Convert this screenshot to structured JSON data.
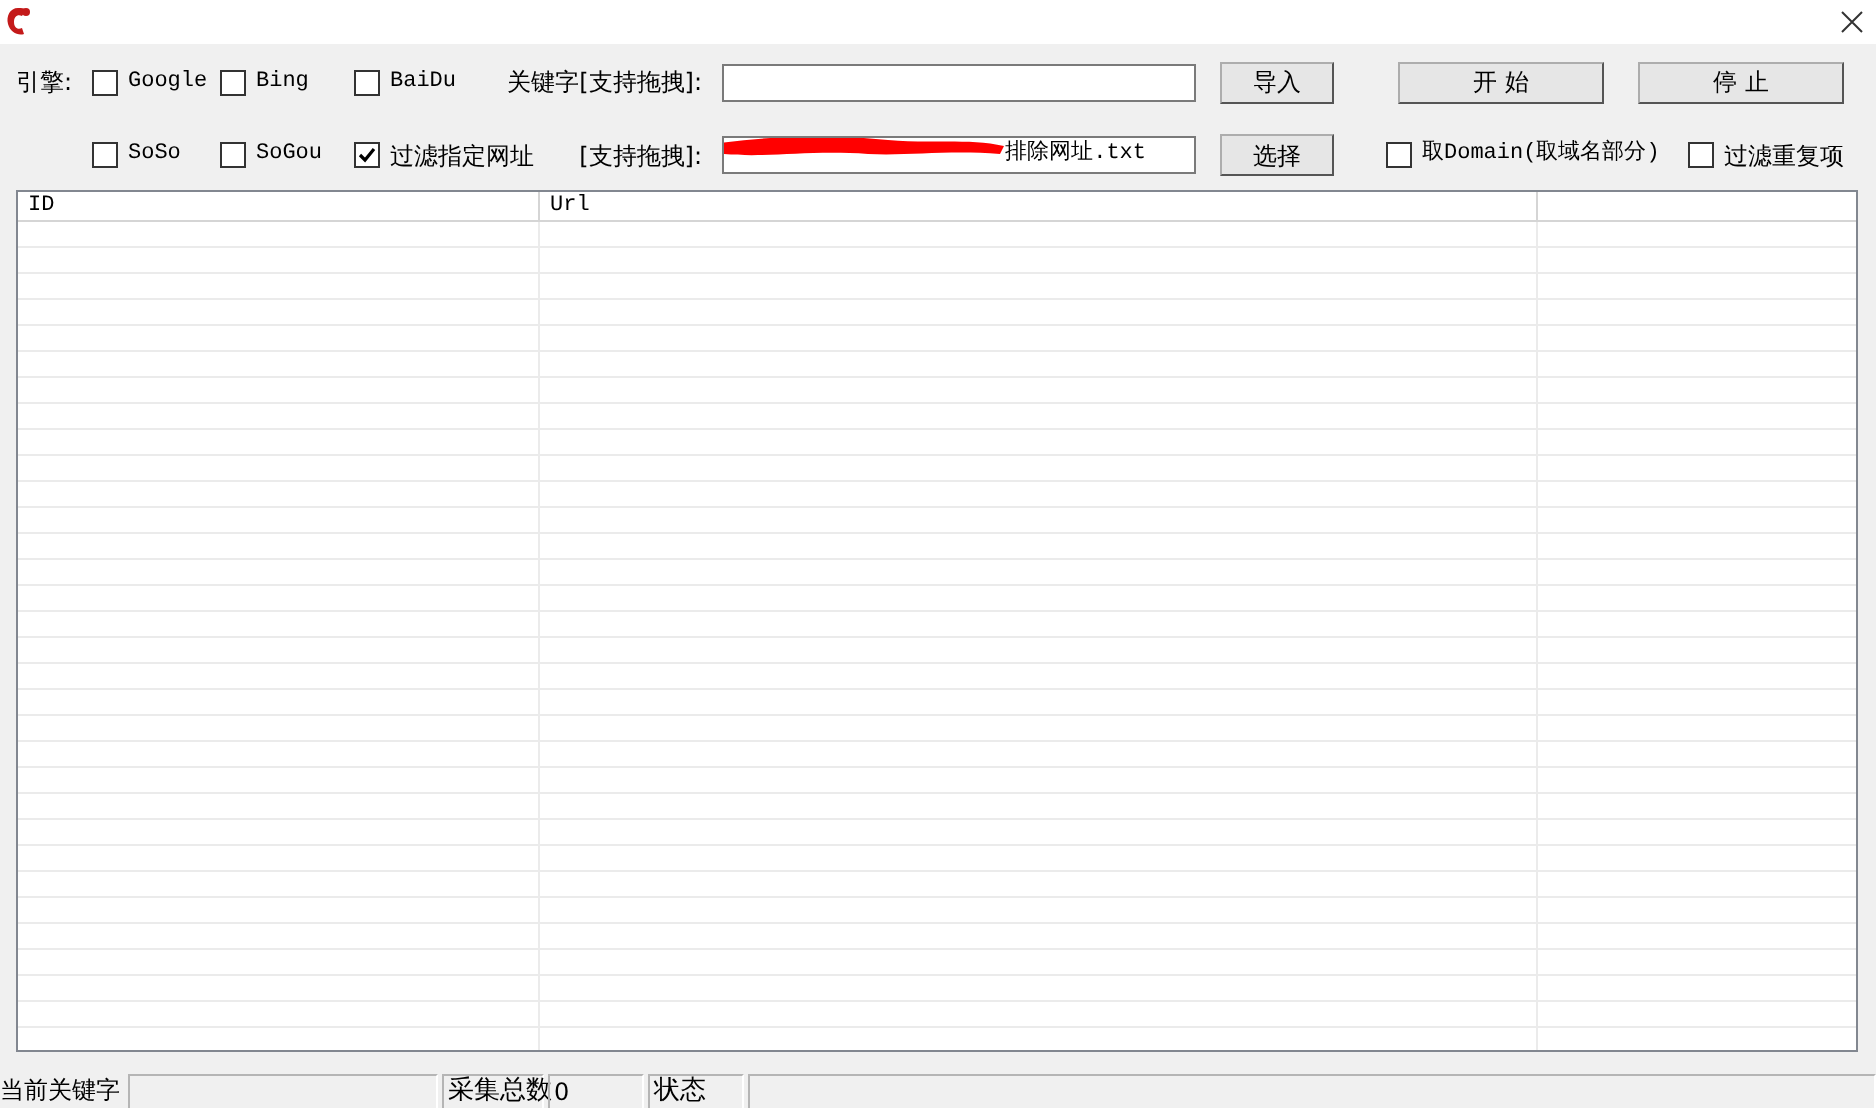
{
  "engine_label": "引擎:",
  "row1_options": [
    {
      "label": "Google",
      "checked": false
    },
    {
      "label": "Bing",
      "checked": false
    },
    {
      "label": "BaiDu",
      "checked": false
    }
  ],
  "keyword": {
    "label": "关键字[支持拖拽]:"
  },
  "import_button": "导入",
  "start_button": "开 始",
  "stop_button": "停 止",
  "row2_options": [
    {
      "label": "SoSo",
      "checked": false
    },
    {
      "label": "SoGou",
      "checked": false
    },
    {
      "label": "过滤指定网址",
      "checked": true
    }
  ],
  "filter_file": {
    "label": "[支持拖拽]:",
    "value": "排除网址.txt",
    "redacted": true
  },
  "select_button": "选择",
  "extra_options": [
    {
      "label": "取Domain(取域名部分)",
      "checked": false
    },
    {
      "label": "过滤重复项",
      "checked": false
    }
  ],
  "table": {
    "columns": [
      "ID",
      "Url"
    ]
  },
  "status_bar": {
    "keyword_label": "当前关键字",
    "count_label": "采集总数",
    "count": "0",
    "status_label": "状态"
  }
}
